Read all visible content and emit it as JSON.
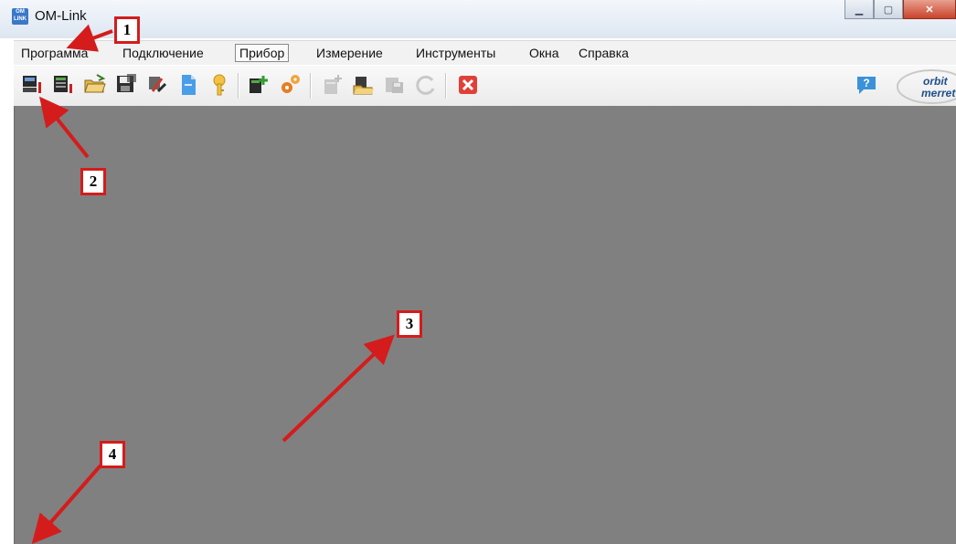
{
  "window": {
    "title": "OM-Link",
    "icon_text_top": "OM",
    "icon_text_bottom": "LINK"
  },
  "menu": [
    {
      "label": "Программа"
    },
    {
      "label": "Подключение"
    },
    {
      "label": "Прибор"
    },
    {
      "label": "Измерение"
    },
    {
      "label": "Инструменты"
    },
    {
      "label": "Окна"
    },
    {
      "label": "Справка"
    }
  ],
  "toolbar": {
    "icons": [
      "connect-device-icon",
      "device-config-icon",
      "open-folder-icon",
      "save-icon",
      "tools-icon",
      "document-icon",
      "key-icon",
      "add-device-icon",
      "settings-gears-icon",
      "new-measurement-icon",
      "open-measurement-icon",
      "save-measurement-icon",
      "refresh-icon",
      "close-icon",
      "help-icon"
    ],
    "logo_line1": "orbit",
    "logo_line2": "merret"
  },
  "callouts": [
    "1",
    "2",
    "3",
    "4"
  ],
  "colors": {
    "workspace": "#808080",
    "callout_border": "#d41c1c",
    "arrow": "#d41c1c"
  }
}
